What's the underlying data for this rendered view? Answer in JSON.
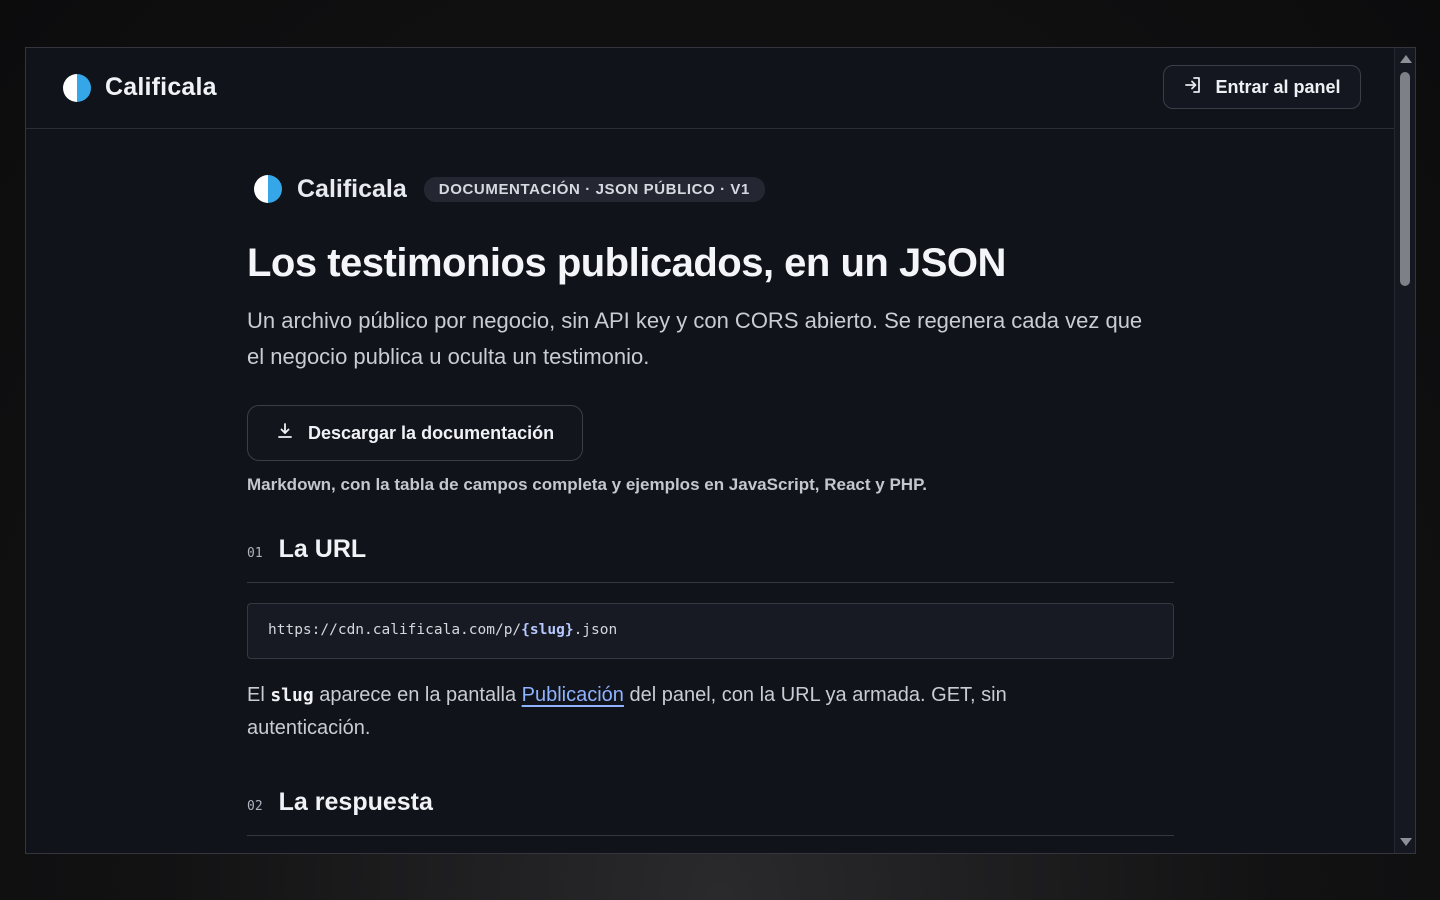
{
  "app": {
    "brand_name": "Calificala",
    "login_label": "Entrar al panel"
  },
  "doc": {
    "brand_name": "Calificala",
    "badge": "DOCUMENTACIÓN · JSON PÚBLICO · V1",
    "title": "Los testimonios publicados, en un JSON",
    "lead": "Un archivo público por negocio, sin API key y con CORS abierto. Se regenera cada vez que el negocio publica u oculta un testimonio.",
    "download_label": "Descargar la documentación",
    "download_note": "Markdown, con la tabla de campos completa y ejemplos en JavaScript, React y PHP."
  },
  "sections": [
    {
      "num": "01",
      "title": "La URL",
      "code_prefix": "https://cdn.calificala.com/p/",
      "code_slug": "{slug}",
      "code_suffix": ".json",
      "text_1": "El ",
      "text_code": "slug",
      "text_2": " aparece en la pantalla ",
      "text_link": "Publicación",
      "text_3": " del panel, con la URL ya armada. GET, sin autenticación."
    },
    {
      "num": "02",
      "title": "La respuesta"
    }
  ],
  "colors": {
    "background": "#11131a",
    "accent_blue": "#35a6e8",
    "link": "#8fb3ff"
  },
  "icons": [
    "logo-mark",
    "login-icon",
    "download-icon"
  ]
}
